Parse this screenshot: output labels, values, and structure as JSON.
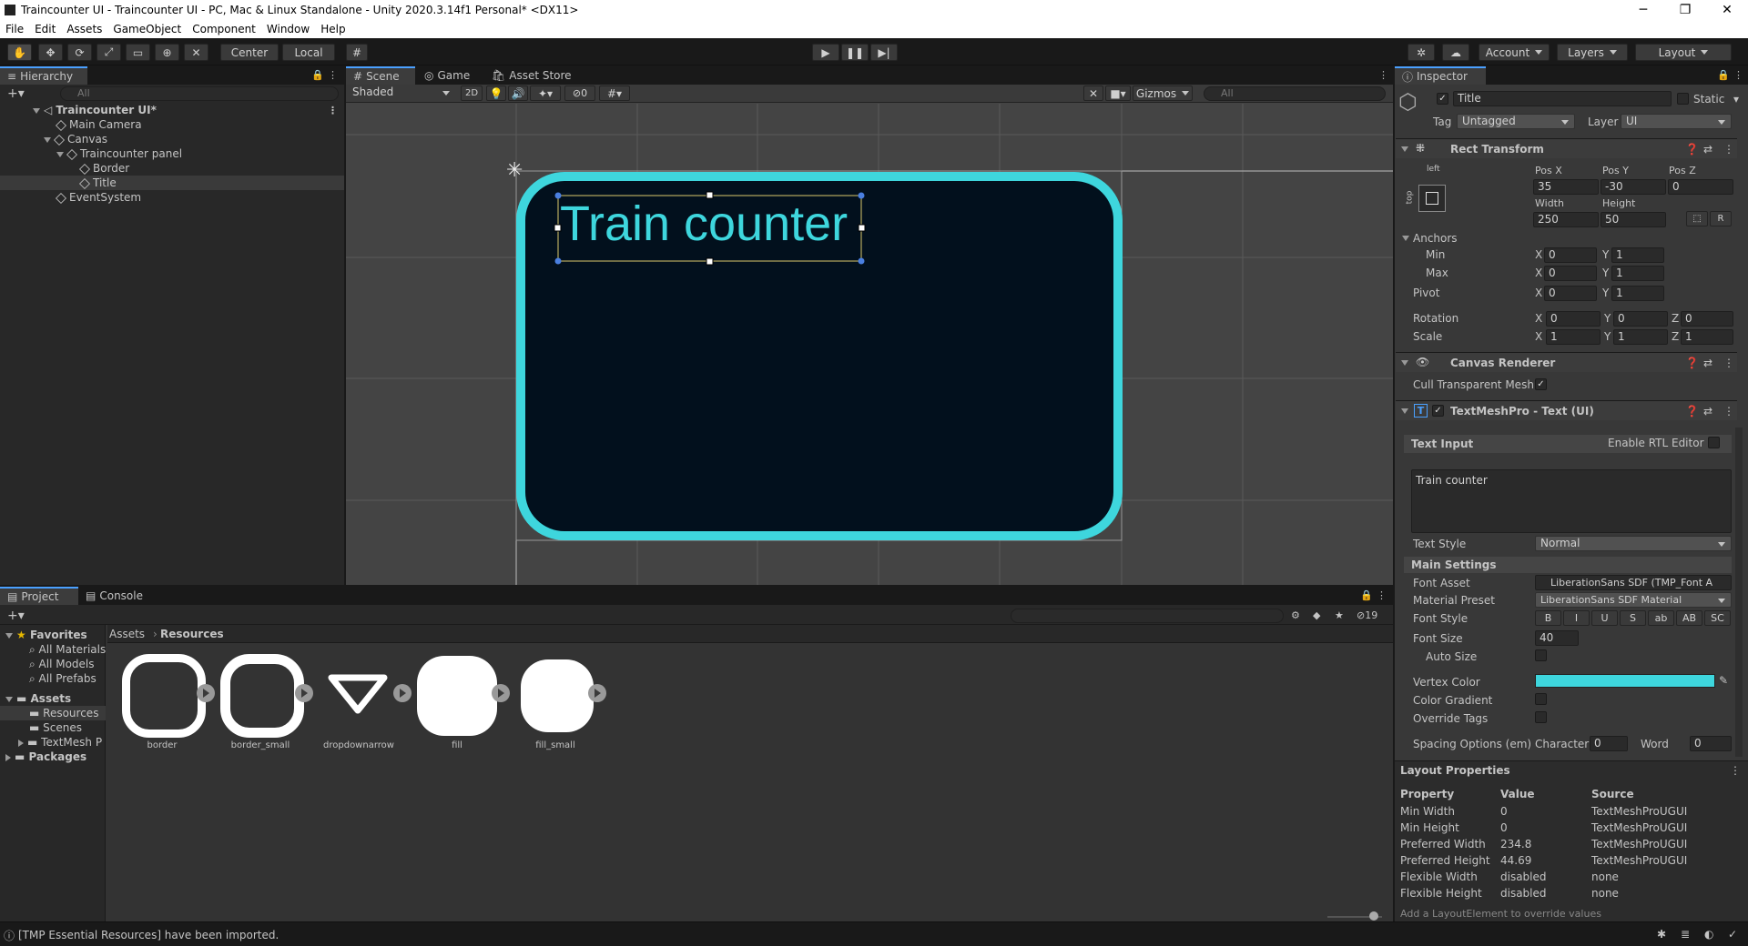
{
  "window": {
    "title": "Traincounter UI - Traincounter UI - PC, Mac & Linux Standalone - Unity 2020.3.14f1 Personal* <DX11>"
  },
  "menu": [
    "File",
    "Edit",
    "Assets",
    "GameObject",
    "Component",
    "Window",
    "Help"
  ],
  "toolbar": {
    "pivot": "Center",
    "space": "Local",
    "account": "Account",
    "layers": "Layers",
    "layout": "Layout"
  },
  "hierarchy": {
    "tab": "Hierarchy",
    "search_placeholder": "All",
    "items": [
      {
        "label": "Traincounter UI*"
      },
      {
        "label": "Main Camera"
      },
      {
        "label": "Canvas"
      },
      {
        "label": "Traincounter panel"
      },
      {
        "label": "Border"
      },
      {
        "label": "Title"
      },
      {
        "label": "EventSystem"
      }
    ]
  },
  "scene": {
    "tabs": [
      "Scene",
      "Game",
      "Asset Store"
    ],
    "shading": "Shaded",
    "mode2d": "2D",
    "hidden_count": "0",
    "gizmos": "Gizmos",
    "search_placeholder": "All",
    "title_text": "Train counter",
    "colors": {
      "border": "#3ed6dd",
      "fill": "#02101d",
      "text": "#3ed6dd"
    }
  },
  "inspector": {
    "tab": "Inspector",
    "object_name": "Title",
    "static": "Static",
    "tag_label": "Tag",
    "tag": "Untagged",
    "layer_label": "Layer",
    "layer": "UI",
    "rect": {
      "title": "Rect Transform",
      "anchor_h": "left",
      "anchor_v": "top",
      "posx_label": "Pos X",
      "posy_label": "Pos Y",
      "posz_label": "Pos Z",
      "posx": "35",
      "posy": "-30",
      "posz": "0",
      "width_label": "Width",
      "height_label": "Height",
      "width": "250",
      "height": "50",
      "r_button": "R",
      "anchors": "Anchors",
      "min": "Min",
      "max": "Max",
      "min_x": "0",
      "min_y": "1",
      "max_x": "0",
      "max_y": "1",
      "pivot": "Pivot",
      "pivot_x": "0",
      "pivot_y": "1",
      "rotation": "Rotation",
      "rot_x": "0",
      "rot_y": "0",
      "rot_z": "0",
      "scale": "Scale",
      "scale_x": "1",
      "scale_y": "1",
      "scale_z": "1",
      "x": "X",
      "y": "Y",
      "z": "Z"
    },
    "canvas_renderer": {
      "title": "Canvas Renderer",
      "cull": "Cull Transparent Mesh"
    },
    "tmp": {
      "title": "TextMeshPro - Text (UI)",
      "text_input": "Text Input",
      "rtl": "Enable RTL Editor",
      "text": "Train counter",
      "text_style_label": "Text Style",
      "text_style": "Normal",
      "main_settings": "Main Settings",
      "font_asset_label": "Font Asset",
      "font_asset": "LiberationSans SDF (TMP_Font A",
      "material_label": "Material Preset",
      "material": "LiberationSans SDF Material",
      "font_style_label": "Font Style",
      "styles": [
        "B",
        "I",
        "U",
        "S",
        "ab",
        "AB",
        "SC"
      ],
      "font_size_label": "Font Size",
      "font_size": "40",
      "auto_size": "Auto Size",
      "vertex_color": "Vertex Color",
      "vertex_color_value": "#3ed6dd",
      "color_gradient": "Color Gradient",
      "override_tags": "Override Tags",
      "spacing": "Spacing Options (em)",
      "character": "Character",
      "character_value": "0",
      "word": "Word",
      "word_value": "0"
    },
    "layout_properties": {
      "title": "Layout Properties",
      "headers": [
        "Property",
        "Value",
        "Source"
      ],
      "rows": [
        [
          "Min Width",
          "0",
          "TextMeshProUGUI"
        ],
        [
          "Min Height",
          "0",
          "TextMeshProUGUI"
        ],
        [
          "Preferred Width",
          "234.8",
          "TextMeshProUGUI"
        ],
        [
          "Preferred Height",
          "44.69",
          "TextMeshProUGUI"
        ],
        [
          "Flexible Width",
          "disabled",
          "none"
        ],
        [
          "Flexible Height",
          "disabled",
          "none"
        ]
      ],
      "footer": "Add a LayoutElement to override values"
    }
  },
  "project": {
    "tabs": [
      "Project",
      "Console"
    ],
    "hidden_count": "19",
    "breadcrumb": [
      "Assets",
      "Resources"
    ],
    "tree": {
      "favorites": "Favorites",
      "fav_items": [
        "All Materials",
        "All Models",
        "All Prefabs"
      ],
      "assets": "Assets",
      "asset_items": [
        "Resources",
        "Scenes",
        "TextMesh P"
      ],
      "packages": "Packages"
    },
    "assets": [
      "border",
      "border_small",
      "dropdownarrow",
      "fill",
      "fill_small"
    ]
  },
  "status": {
    "message": "[TMP Essential Resources] have been imported."
  }
}
